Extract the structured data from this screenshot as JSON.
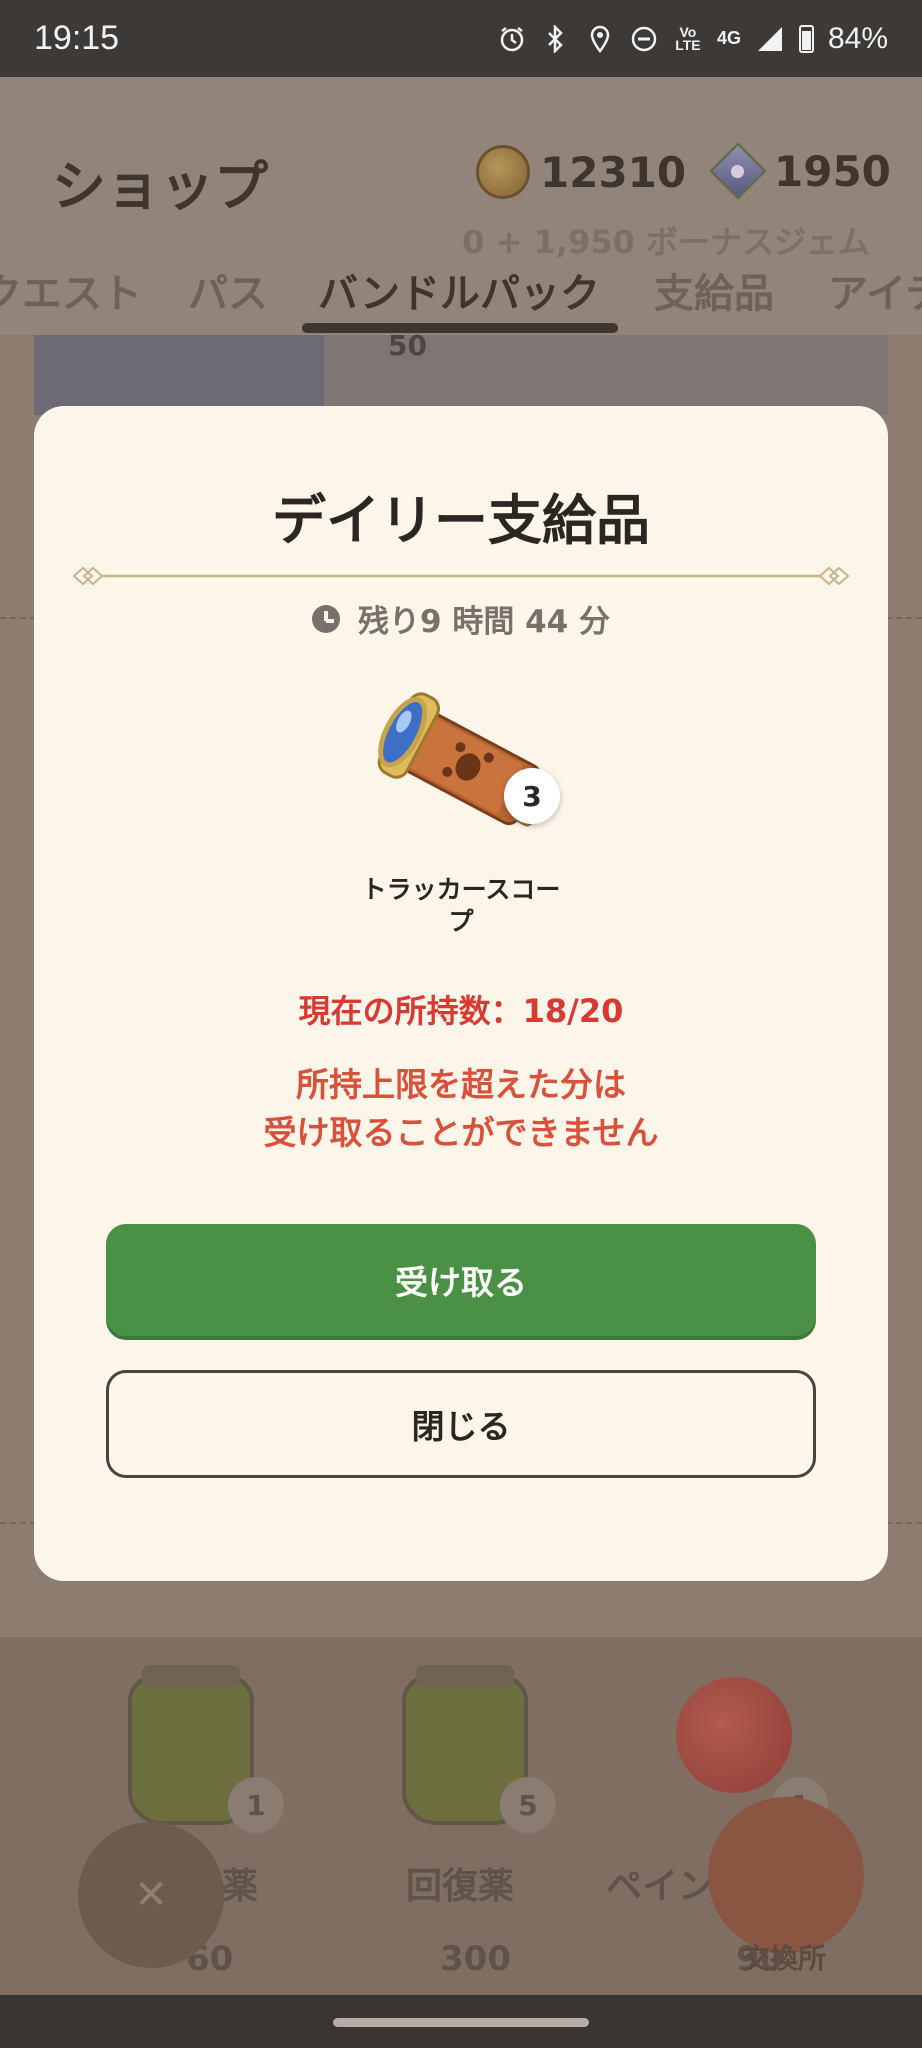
{
  "status_bar": {
    "time": "19:15",
    "volte_label": "Vo LTE",
    "network": "4G",
    "battery": "84%",
    "icons": [
      "alarm-icon",
      "bluetooth-icon",
      "location-icon",
      "dnd-icon",
      "volte-icon",
      "signal-icon",
      "battery-icon"
    ]
  },
  "header": {
    "title": "ショップ",
    "coins": "12310",
    "gems": "1950",
    "bonus_text": "0 + 1,950 ボーナスジェム"
  },
  "tabs": [
    {
      "label": "クエスト"
    },
    {
      "label": "パス"
    },
    {
      "label": "バンドルパック",
      "active": true
    },
    {
      "label": "支給品"
    },
    {
      "label": "アイテ"
    }
  ],
  "background": {
    "card_badge": "50",
    "items": [
      {
        "name": "復薬",
        "count": "1",
        "price": "60"
      },
      {
        "name": "回復薬",
        "count": "5",
        "price": "300"
      },
      {
        "name": "ペイン",
        "count": "1",
        "price": "90"
      }
    ],
    "exchange_label": "交換所"
  },
  "modal": {
    "title": "デイリー支給品",
    "timer": "残り9 時間 44 分",
    "item": {
      "name_line1": "トラッカースコー",
      "name_line2": "プ",
      "quantity": "3"
    },
    "owned_text": "現在の所持数：18/20",
    "warning_line1": "所持上限を超えた分は",
    "warning_line2": "受け取ることができません",
    "receive_label": "受け取る",
    "close_label": "閉じる"
  },
  "colors": {
    "modal_bg": "#fcf5ea",
    "receive_green": "#4a9045",
    "warning_red": "#d73a32",
    "title_text": "#2c2622"
  }
}
